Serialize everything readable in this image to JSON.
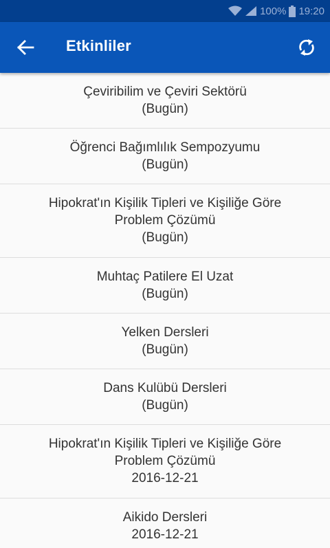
{
  "status_bar": {
    "battery": "100%",
    "time": "19:20"
  },
  "app_bar": {
    "title": "Etkinliler",
    "back_icon": "arrow-left-icon",
    "refresh_icon": "refresh-icon",
    "background_color": "#0a56b8",
    "status_color": "#033f8e"
  },
  "events": [
    {
      "title_lines": [
        "Çeviribilim ve Çeviri Sektörü"
      ],
      "date": "(Bugün)"
    },
    {
      "title_lines": [
        "Öğrenci Bağımlılık Sempozyumu"
      ],
      "date": "(Bugün)"
    },
    {
      "title_lines": [
        "Hipokrat'ın Kişilik Tipleri ve Kişiliğe Göre",
        "Problem Çözümü"
      ],
      "date": "(Bugün)"
    },
    {
      "title_lines": [
        "Muhtaç Patilere El Uzat"
      ],
      "date": "(Bugün)"
    },
    {
      "title_lines": [
        "Yelken Dersleri"
      ],
      "date": "(Bugün)"
    },
    {
      "title_lines": [
        "Dans Kulübü Dersleri"
      ],
      "date": "(Bugün)"
    },
    {
      "title_lines": [
        "Hipokrat'ın Kişilik Tipleri ve Kişiliğe Göre",
        "Problem Çözümü"
      ],
      "date": "2016-12-21"
    },
    {
      "title_lines": [
        "Aikido Dersleri"
      ],
      "date": "2016-12-21"
    }
  ]
}
